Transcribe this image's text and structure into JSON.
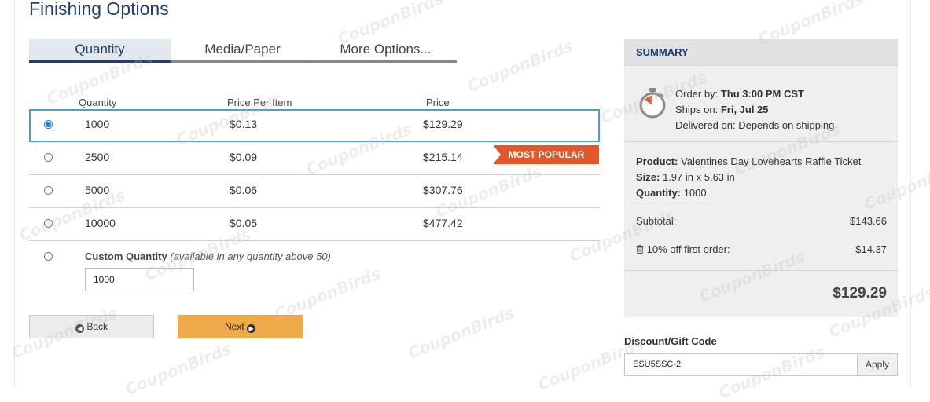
{
  "page_title": "Finishing Options",
  "tabs": [
    {
      "label": "Quantity",
      "active": true
    },
    {
      "label": "Media/Paper",
      "active": false
    },
    {
      "label": "More Options...",
      "active": false
    }
  ],
  "table": {
    "columns": [
      "Quantity",
      "Price Per Item",
      "Price"
    ],
    "rows": [
      {
        "quantity": "1000",
        "price_per_item": "$0.13",
        "price": "$129.29",
        "selected": true
      },
      {
        "quantity": "2500",
        "price_per_item": "$0.09",
        "price": "$215.14",
        "selected": false,
        "badge": "MOST POPULAR"
      },
      {
        "quantity": "5000",
        "price_per_item": "$0.06",
        "price": "$307.76",
        "selected": false
      },
      {
        "quantity": "10000",
        "price_per_item": "$0.05",
        "price": "$477.42",
        "selected": false
      }
    ]
  },
  "custom_quantity": {
    "label": "Custom Quantity",
    "note": "(available in any quantity above 50)",
    "value": "1000"
  },
  "buttons": {
    "back": "Back",
    "next": "Next"
  },
  "summary": {
    "title": "SUMMARY",
    "order_by_label": "Order by:",
    "order_by_value": "Thu 3:00 PM CST",
    "ships_on_label": "Ships on:",
    "ships_on_value": "Fri, Jul 25",
    "delivered_on": "Delivered on: Depends on shipping",
    "product_label": "Product:",
    "product_value": "Valentines Day Lovehearts Raffle Ticket",
    "size_label": "Size:",
    "size_value": "1.97 in x 5.63 in",
    "quantity_label": "Quantity:",
    "quantity_value": "1000",
    "subtotal_label": "Subtotal:",
    "subtotal_value": "$143.66",
    "discount_label": "10% off first order:",
    "discount_value": "-$14.37",
    "total": "$129.29"
  },
  "discount_code": {
    "label": "Discount/Gift Code",
    "value": "ESU5SSC-2",
    "apply": "Apply"
  },
  "watermark": "CouponBirds",
  "colors": {
    "brand": "#1d3e6e",
    "badge": "#e2582a",
    "next_button": "#efab4b",
    "selected_border": "#4a9ed2",
    "stopwatch_accent": "#e05a1e"
  }
}
